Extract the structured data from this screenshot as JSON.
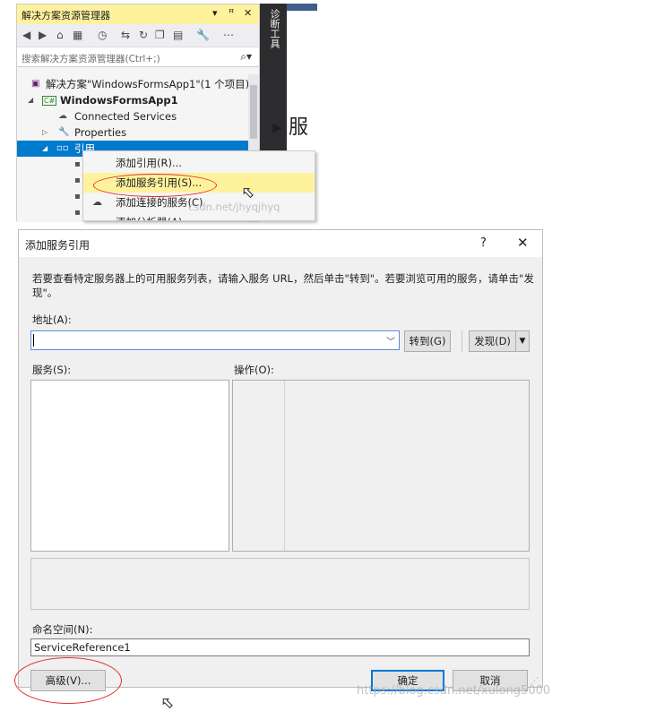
{
  "solution_explorer": {
    "title": "解决方案资源管理器",
    "title_controls": [
      "▾",
      "ꟸ",
      "✕"
    ],
    "search_placeholder": "搜索解决方案资源管理器(Ctrl+;)",
    "tree": [
      {
        "label": "解决方案\"WindowsFormsApp1\"(1 个项目)",
        "icon": "solution-icon"
      },
      {
        "label": "WindowsFormsApp1",
        "icon": "csharp-project-icon",
        "bold": true
      },
      {
        "label": "Connected Services",
        "icon": "connected-services-icon"
      },
      {
        "label": "Properties",
        "icon": "wrench-icon"
      },
      {
        "label": "引用",
        "icon": "references-icon",
        "selected": true
      }
    ]
  },
  "diagnostic_tools": {
    "label": "诊断工具"
  },
  "background_text": "服",
  "context_menu": {
    "items": [
      {
        "label": "添加引用(R)..."
      },
      {
        "label": "添加服务引用(S)...",
        "highlighted": true
      },
      {
        "label": "添加连接的服务(C)"
      },
      {
        "label": "添加分析器(A)..."
      }
    ]
  },
  "watermark_top": "csdn.net/jhyqjhyq",
  "dialog": {
    "title": "添加服务引用",
    "help": "?",
    "close": "✕",
    "description": "若要查看特定服务器上的可用服务列表，请输入服务 URL，然后单击\"转到\"。若要浏览可用的服务，请单击\"发现\"。",
    "address_label": "地址(A):",
    "address_value": "",
    "go_button": "转到(G)",
    "discover_button": "发现(D)",
    "services_label": "服务(S):",
    "operations_label": "操作(O):",
    "namespace_label": "命名空间(N):",
    "namespace_value": "ServiceReference1",
    "advanced_button": "高级(V)...",
    "ok_button": "确定",
    "cancel_button": "取消"
  },
  "watermark_bottom": "https://blog.csdn.net/xulong5000",
  "colors": {
    "highlight": "#fff29d",
    "annotation": "#e0312b",
    "selection": "#007acc"
  }
}
